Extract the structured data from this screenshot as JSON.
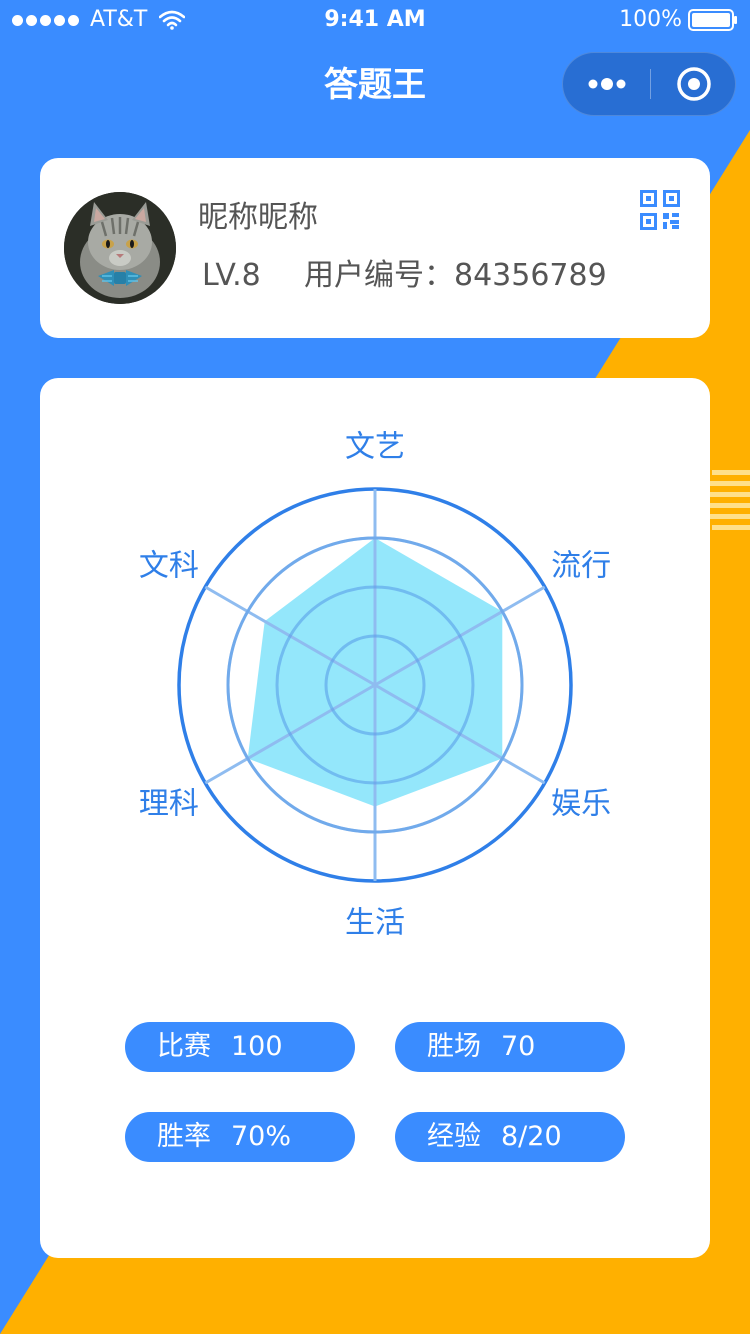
{
  "status_bar": {
    "carrier": "AT&T",
    "time": "9:41 AM",
    "battery": "100%"
  },
  "nav": {
    "title": "答题王",
    "more_icon": "more-dots-icon",
    "close_icon": "target-close-icon"
  },
  "profile": {
    "nickname": "昵称昵称",
    "level": "LV.8",
    "user_id_label": "用户编号：",
    "user_id": "84356789",
    "qr_icon": "qr-code-icon"
  },
  "chart_data": {
    "type": "radar",
    "axes": [
      "文艺",
      "流行",
      "娱乐",
      "生活",
      "理科",
      "文科"
    ],
    "values": [
      0.75,
      0.75,
      0.75,
      0.62,
      0.75,
      0.65
    ],
    "rings": 4,
    "fill_color": "#8ee6fb",
    "ring_color_outer": "#2f7fe8",
    "ring_color_inner": "#8fbcf0"
  },
  "stats": [
    {
      "label": "比赛",
      "value": "100"
    },
    {
      "label": "胜场",
      "value": "70"
    },
    {
      "label": "胜率",
      "value": "70%"
    },
    {
      "label": "经验",
      "value": "8/20"
    }
  ],
  "colors": {
    "primary_blue": "#3a8cff",
    "accent_orange": "#ffb000",
    "card": "#ffffff"
  }
}
